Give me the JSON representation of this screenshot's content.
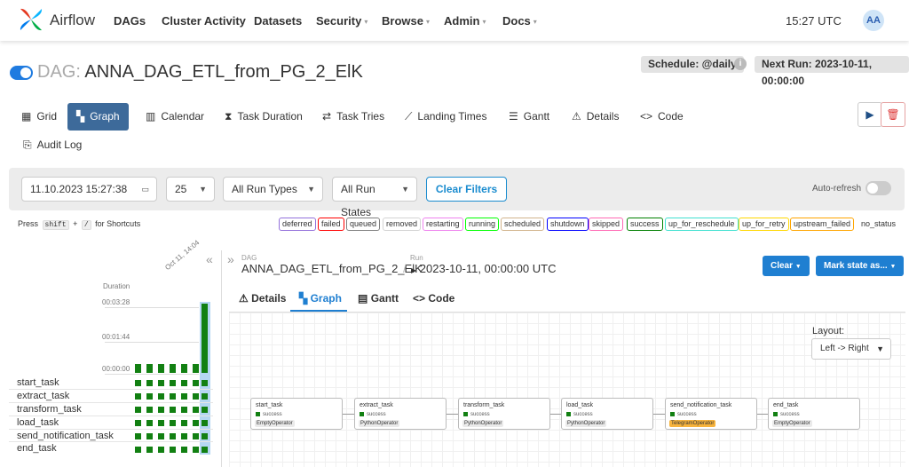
{
  "brand": {
    "name": "Airflow"
  },
  "nav": {
    "items": [
      {
        "label": "DAGs"
      },
      {
        "label": "Cluster Activity"
      },
      {
        "label": "Datasets"
      },
      {
        "label": "Security"
      },
      {
        "label": "Browse"
      },
      {
        "label": "Admin"
      },
      {
        "label": "Docs"
      }
    ]
  },
  "clock": "15:27 UTC",
  "user_initials": "AA",
  "dag": {
    "prefix": "DAG:",
    "name": "ANNA_DAG_ETL_from_PG_2_ElK",
    "schedule": "Schedule: @daily",
    "next_run": "Next Run: 2023-10-11, 00:00:00",
    "paused": false
  },
  "tabs": [
    {
      "label": "Grid"
    },
    {
      "label": "Graph"
    },
    {
      "label": "Calendar"
    },
    {
      "label": "Task Duration"
    },
    {
      "label": "Task Tries"
    },
    {
      "label": "Landing Times"
    },
    {
      "label": "Gantt"
    },
    {
      "label": "Details"
    },
    {
      "label": "Code"
    },
    {
      "label": "Audit Log"
    }
  ],
  "filters": {
    "date": "11.10.2023 15:27:38",
    "num_runs": "25",
    "run_types": "All Run Types",
    "run_states": "All Run States",
    "clear": "Clear Filters",
    "auto_refresh": "Auto-refresh"
  },
  "shortcuts": {
    "press": "Press",
    "key1": "shift",
    "plus": "+",
    "key2": "/",
    "suffix": "for Shortcuts"
  },
  "states": [
    {
      "label": "deferred",
      "color": "#9370db"
    },
    {
      "label": "failed",
      "color": "#ff0000"
    },
    {
      "label": "queued",
      "color": "#808080"
    },
    {
      "label": "removed",
      "color": "#d3d3d3"
    },
    {
      "label": "restarting",
      "color": "#ee82ee"
    },
    {
      "label": "running",
      "color": "#00ff00"
    },
    {
      "label": "scheduled",
      "color": "#d2b48c"
    },
    {
      "label": "shutdown",
      "color": "#0000ff"
    },
    {
      "label": "skipped",
      "color": "#ff69b4"
    },
    {
      "label": "success",
      "color": "#008000"
    },
    {
      "label": "up_for_reschedule",
      "color": "#40e0d0"
    },
    {
      "label": "up_for_retry",
      "color": "#ffd700"
    },
    {
      "label": "upstream_failed",
      "color": "#ffa500"
    },
    {
      "label": "no_status",
      "color": "#ffffff"
    }
  ],
  "grid": {
    "duration_label": "Duration",
    "durations": [
      "00:03:28",
      "00:01:44",
      "00:00:00"
    ],
    "tilted_label": "Oct 11, 14:04",
    "num_runs_shown": 12,
    "run_state": "success",
    "tasks": [
      "start_task",
      "extract_task",
      "transform_task",
      "load_task",
      "send_notification_task",
      "end_task"
    ]
  },
  "detail": {
    "dag_small": "DAG",
    "dag_name": "ANNA_DAG_ETL_from_PG_2_ElK",
    "sep": "/",
    "run_small": "Run",
    "run_name": "2023-10-11, 00:00:00 UTC",
    "clear_btn": "Clear",
    "mark_btn": "Mark state as...",
    "subtabs": [
      {
        "label": "Details"
      },
      {
        "label": "Graph"
      },
      {
        "label": "Gantt"
      },
      {
        "label": "Code"
      }
    ],
    "layout_label": "Layout:",
    "layout_value": "Left -> Right"
  },
  "nodes": [
    {
      "name": "start_task",
      "state": "success",
      "operator": "EmptyOperator",
      "color": "#eaeaea"
    },
    {
      "name": "extract_task",
      "state": "success",
      "operator": "PythonOperator",
      "color": "#eaeaea"
    },
    {
      "name": "transform_task",
      "state": "success",
      "operator": "PythonOperator",
      "color": "#eaeaea"
    },
    {
      "name": "load_task",
      "state": "success",
      "operator": "PythonOperator",
      "color": "#eaeaea"
    },
    {
      "name": "send_notification_task",
      "state": "success",
      "operator": "TelegramOperator",
      "color": "#f7b33c"
    },
    {
      "name": "end_task",
      "state": "success",
      "operator": "EmptyOperator",
      "color": "#eaeaea"
    }
  ]
}
